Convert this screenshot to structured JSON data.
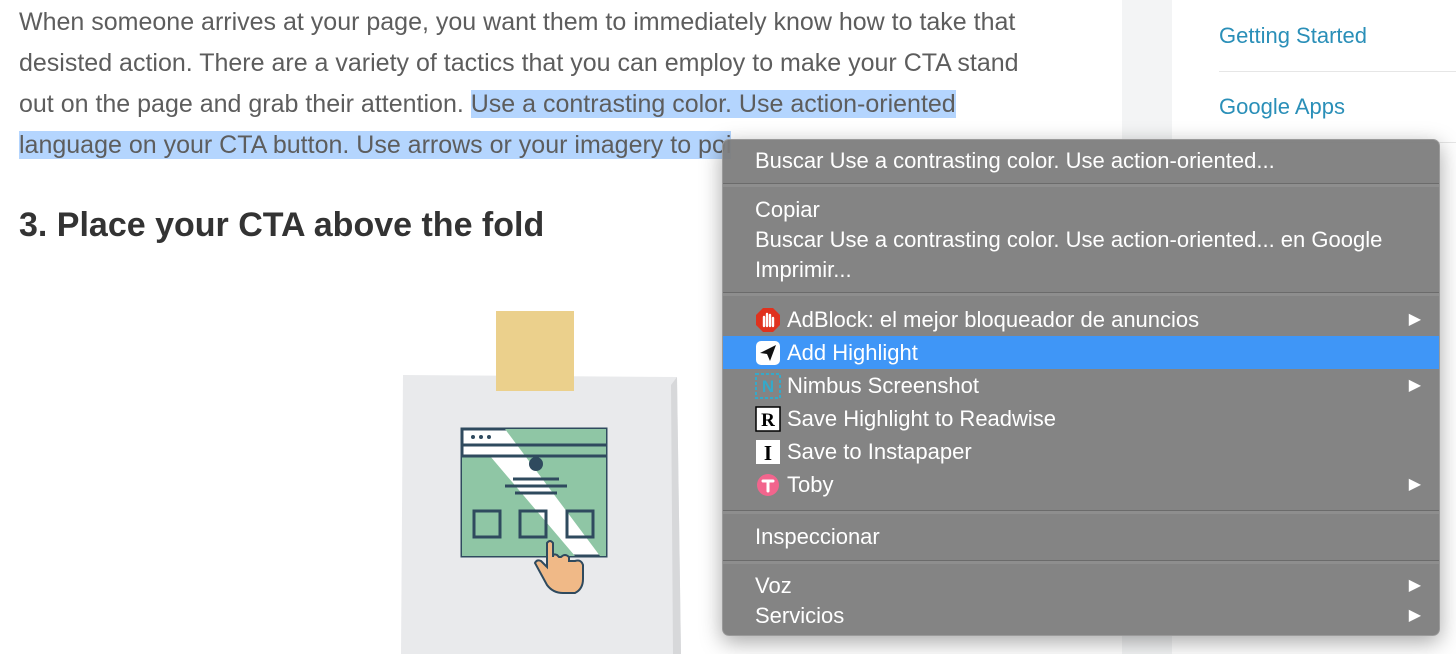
{
  "article": {
    "para_plain": "When someone arrives at your page, you want them to immediately know how to take that desisted action. There are a variety of tactics that you can employ to make your CTA stand out on the page and grab their attention. ",
    "para_selected": "Use a contrasting color. Use action-oriented language on your CTA button. Use arrows or your imagery to poi",
    "heading": "3. Place your CTA above the fold"
  },
  "sidebar": {
    "links": [
      "Getting Started",
      "Google Apps"
    ]
  },
  "context_menu": {
    "search_selection": "Buscar Use a contrasting color. Use action-oriented...",
    "copy": "Copiar",
    "search_google": "Buscar Use a contrasting color. Use action-oriented... en Google",
    "print": "Imprimir...",
    "extensions": [
      {
        "label": "AdBlock: el mejor bloqueador de anuncios",
        "icon": "adblock-hand-icon",
        "submenu": true
      },
      {
        "label": "Add Highlight",
        "icon": "paper-plane-icon",
        "submenu": false,
        "active": true
      },
      {
        "label": "Nimbus Screenshot",
        "icon": "nimbus-n-icon",
        "submenu": true
      },
      {
        "label": "Save Highlight to Readwise",
        "icon": "readwise-r-icon",
        "submenu": false
      },
      {
        "label": "Save to Instapaper",
        "icon": "instapaper-i-icon",
        "submenu": false
      },
      {
        "label": "Toby",
        "icon": "toby-icon",
        "submenu": true
      }
    ],
    "inspect": "Inspeccionar",
    "speech": "Voz",
    "services": "Servicios",
    "submenu_arrow": "▶"
  },
  "colors": {
    "selection": "#b4d5fe",
    "menu_active": "#3f96f7",
    "link": "#2a8fb8"
  }
}
